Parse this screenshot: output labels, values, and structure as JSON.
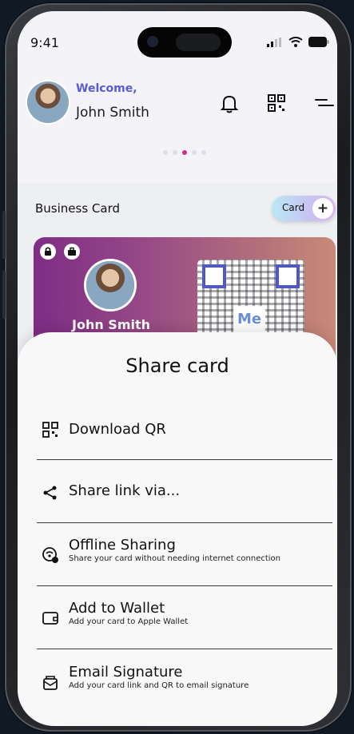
{
  "status_bar": {
    "time": "9:41"
  },
  "header": {
    "welcome": "Welcome,",
    "user_name": "John Smith"
  },
  "carousel": {
    "count": 5,
    "active_index": 2
  },
  "section": {
    "title": "Business Card",
    "card_button_label": "Card",
    "card_button_plus": "+"
  },
  "business_card": {
    "name": "John Smith",
    "qr_logo": "Me"
  },
  "share_sheet": {
    "title": "Share card",
    "options": [
      {
        "title": "Download QR",
        "subtitle": "",
        "icon": "qr-code-icon"
      },
      {
        "title": "Share link via...",
        "subtitle": "",
        "icon": "share-icon"
      },
      {
        "title": "Offline Sharing",
        "subtitle": "Share your card without needing internet connection",
        "icon": "offline-sharing-icon"
      },
      {
        "title": "Add to Wallet",
        "subtitle": "Add your card to Apple Wallet",
        "icon": "wallet-icon"
      },
      {
        "title": "Email Signature",
        "subtitle": "Add your card link and QR to email signature",
        "icon": "email-signature-icon"
      }
    ]
  },
  "colors": {
    "accent": "#5a5ad6",
    "active_dot": "#c9318a",
    "card_gradient_start": "#7e2c86",
    "card_gradient_end": "#c98a78"
  }
}
